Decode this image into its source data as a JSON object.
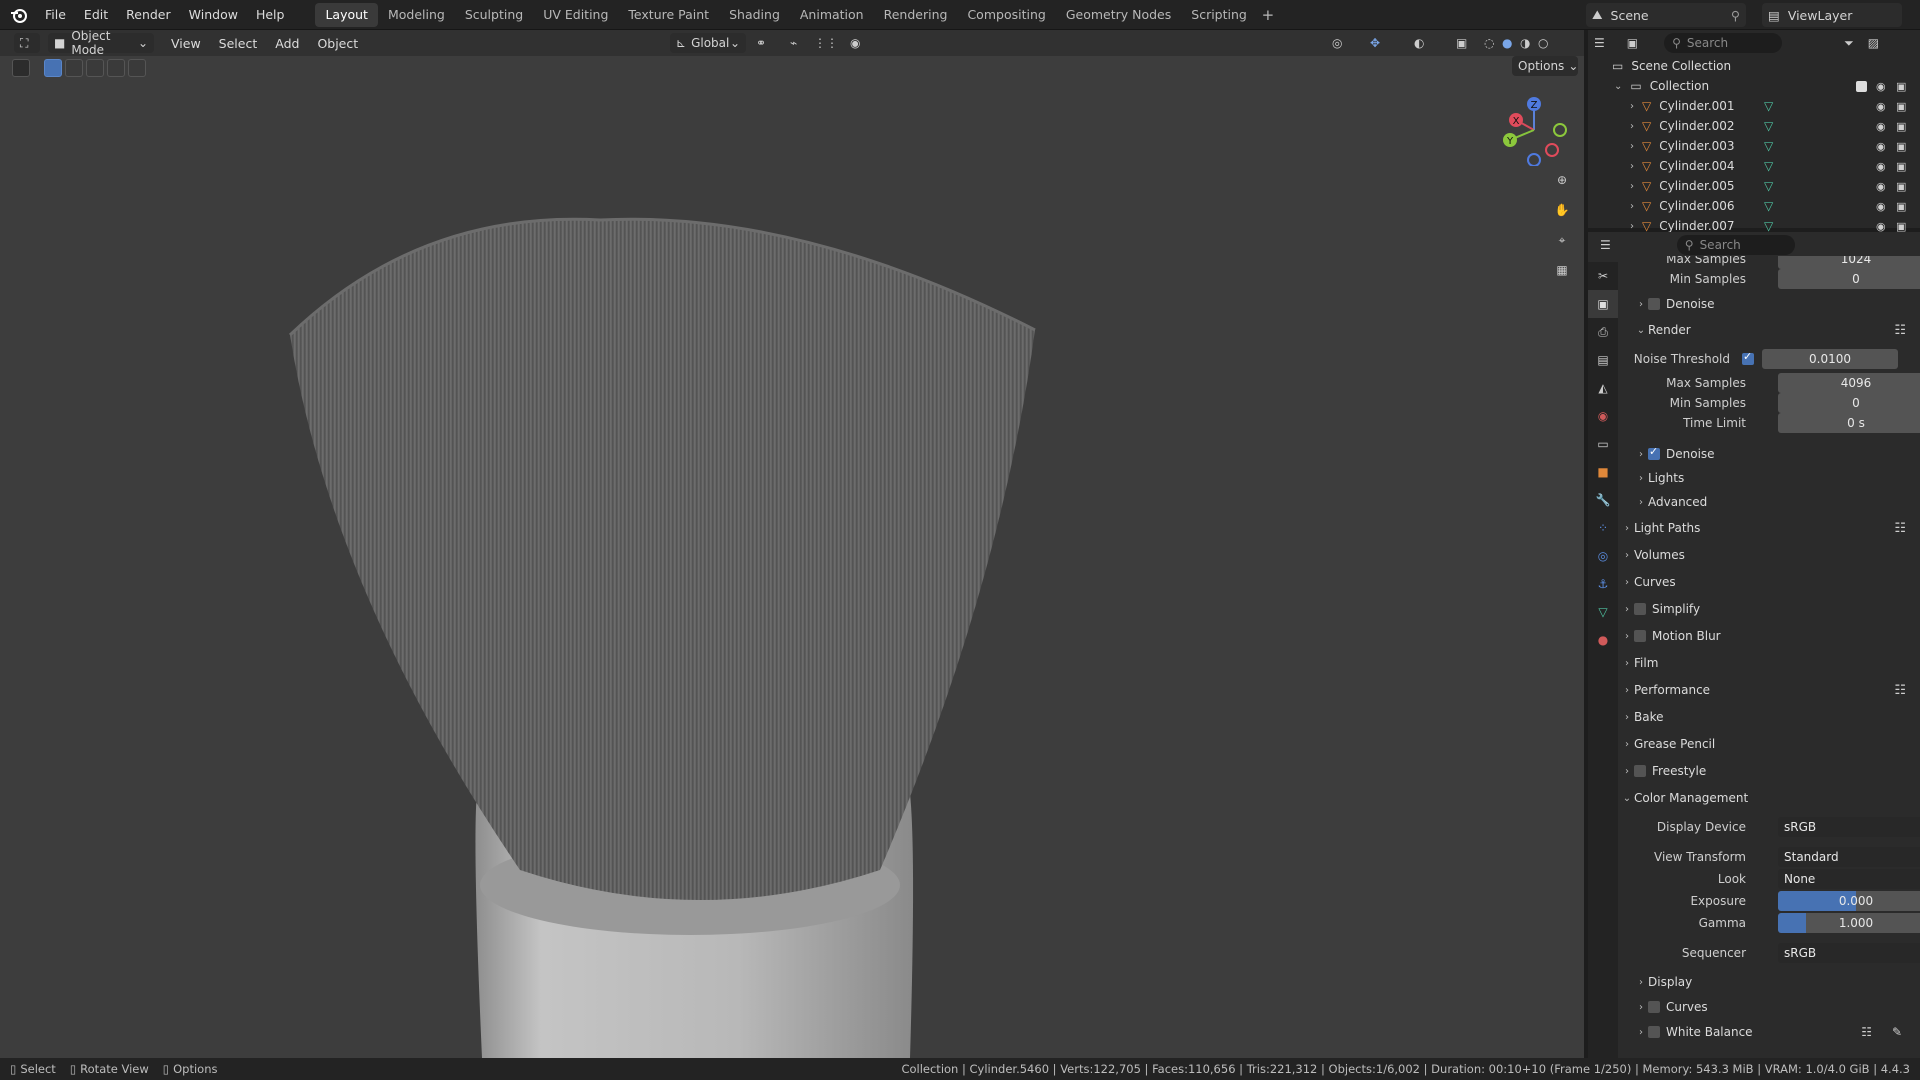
{
  "menu": [
    "File",
    "Edit",
    "Render",
    "Window",
    "Help"
  ],
  "workspaces": [
    "Layout",
    "Modeling",
    "Sculpting",
    "UV Editing",
    "Texture Paint",
    "Shading",
    "Animation",
    "Rendering",
    "Compositing",
    "Geometry Nodes",
    "Scripting"
  ],
  "active_workspace": "Layout",
  "scene_name": "Scene",
  "view_layer": "ViewLayer",
  "viewport": {
    "mode": "Object Mode",
    "menus": [
      "View",
      "Select",
      "Add",
      "Object"
    ],
    "orientation": "Global",
    "options_label": "Options",
    "gizmo": {
      "z": "Z",
      "x": "X",
      "y": "Y"
    }
  },
  "outliner": {
    "search_placeholder": "Search",
    "scene_collection": "Scene Collection",
    "collection": "Collection",
    "objects": [
      "Cylinder.001",
      "Cylinder.002",
      "Cylinder.003",
      "Cylinder.004",
      "Cylinder.005",
      "Cylinder.006",
      "Cylinder.007"
    ]
  },
  "properties": {
    "search_placeholder": "Search",
    "top_max_samples_label": "Max Samples",
    "top_max_samples": "1024",
    "top_min_samples_label": "Min Samples",
    "top_min_samples": "0",
    "denoise_label": "Denoise",
    "render_label": "Render",
    "noise_threshold_label": "Noise Threshold",
    "noise_threshold": "0.0100",
    "max_samples_label": "Max Samples",
    "max_samples": "4096",
    "min_samples_label": "Min Samples",
    "min_samples": "0",
    "time_limit_label": "Time Limit",
    "time_limit": "0 s",
    "denoise2_label": "Denoise",
    "lights_label": "Lights",
    "advanced_label": "Advanced",
    "sections": [
      "Light Paths",
      "Volumes",
      "Curves",
      "Simplify",
      "Motion Blur",
      "Film",
      "Performance",
      "Bake",
      "Grease Pencil",
      "Freestyle",
      "Color Management"
    ],
    "display_device_label": "Display Device",
    "display_device": "sRGB",
    "view_transform_label": "View Transform",
    "view_transform": "Standard",
    "look_label": "Look",
    "look": "None",
    "exposure_label": "Exposure",
    "exposure": "0.000",
    "gamma_label": "Gamma",
    "gamma": "1.000",
    "gamma_fill": 0.18,
    "exposure_fill": 0.5,
    "sequencer_label": "Sequencer",
    "sequencer": "sRGB",
    "sub_sections": [
      "Display",
      "Curves",
      "White Balance"
    ]
  },
  "status": {
    "left": [
      "Select",
      "Rotate View",
      "Options"
    ],
    "right": "Collection | Cylinder.5460 | Verts:122,705 | Faces:110,656 | Tris:221,312 | Objects:1/6,002 | Duration: 00:10+10 (Frame 1/250) | Memory: 543.3 MiB | VRAM: 1.0/4.0 GiB | 4.4.3"
  },
  "colors": {
    "accent": "#4772b3",
    "mesh_icon": "#e0883a",
    "data_icon": "#4fc3a1"
  }
}
